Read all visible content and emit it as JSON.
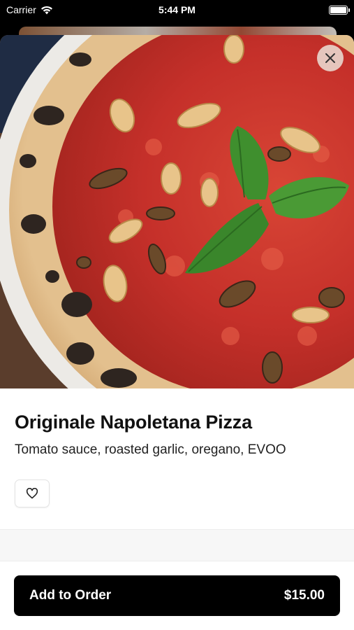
{
  "status_bar": {
    "carrier": "Carrier",
    "time": "5:44 PM"
  },
  "item": {
    "name": "Originale Napoletana Pizza",
    "description": "Tomato sauce, roasted garlic, oregano, EVOO",
    "image_icon": "pizza-photo"
  },
  "actions": {
    "close_icon": "close-icon",
    "favorite_icon": "heart-icon"
  },
  "order_button": {
    "label": "Add to Order",
    "price": "$15.00"
  },
  "colors": {
    "primary": "#000000",
    "sauce": "#c8352a",
    "basil": "#3f8f2e"
  }
}
